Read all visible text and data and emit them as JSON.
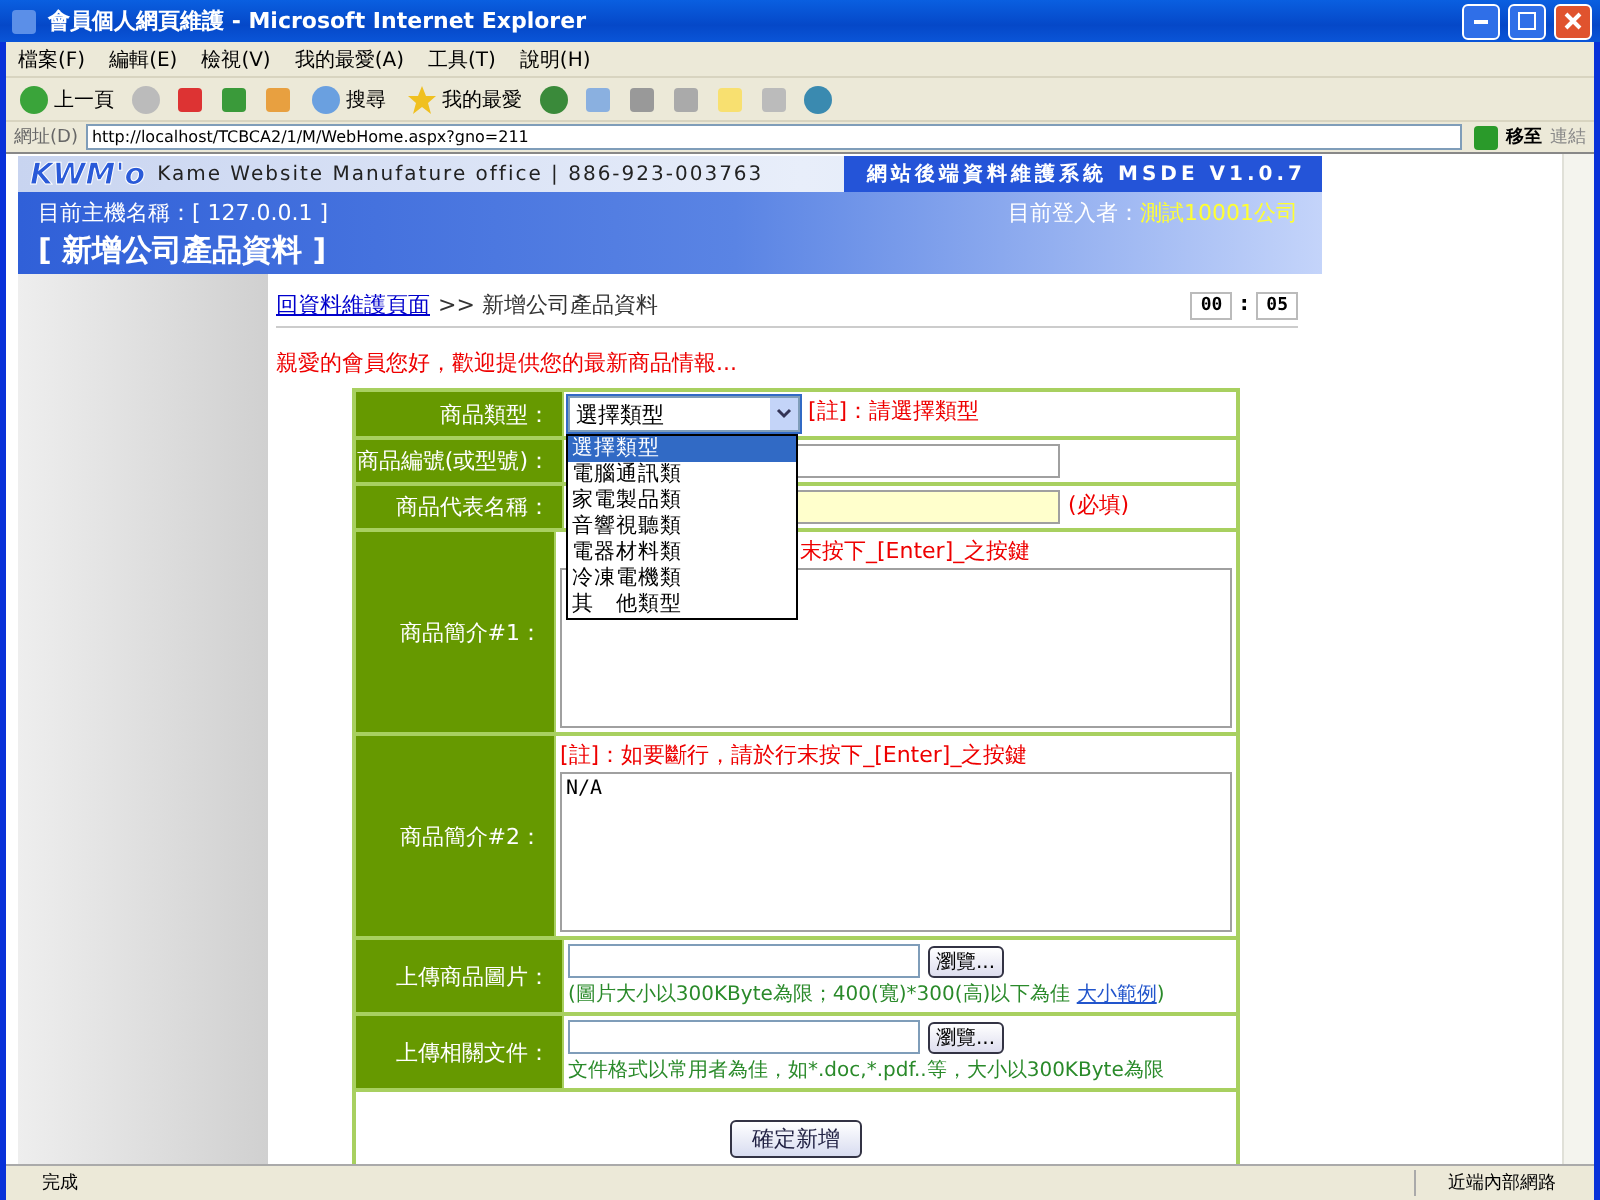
{
  "window": {
    "title": "會員個人網頁維護 - Microsoft Internet Explorer"
  },
  "menu": [
    "檔案(F)",
    "編輯(E)",
    "檢視(V)",
    "我的最愛(A)",
    "工具(T)",
    "說明(H)"
  ],
  "toolbar": {
    "back": "上一頁",
    "search": "搜尋",
    "favorites": "我的最愛"
  },
  "address": {
    "label": "網址(D)",
    "url": "http://localhost/TCBCA2/1/M/WebHome.aspx?gno=211",
    "go": "移至",
    "links": "連結"
  },
  "header": {
    "logo": "KWM'o",
    "company": "Kame Website Manufature office | 886-923-003763",
    "system": "網站後端資料維護系統 MSDE V1.0.7",
    "host": "目前主機名稱：[ 127.0.0.1 ]",
    "user_label": "目前登入者：",
    "user": "測試10001公司",
    "page_title": "[ 新增公司產品資料 ]"
  },
  "breadcrumb": {
    "link": "回資料維護頁面",
    "current": ">> 新增公司產品資料"
  },
  "timer": {
    "minutes": "00",
    "separator": ":",
    "seconds": "05"
  },
  "welcome": "親愛的會員您好，歡迎提供您的最新商品情報...",
  "form": {
    "rows": [
      {
        "kind": "select",
        "label": "商品類型：",
        "value": "選擇類型",
        "note": "[註]：請選擇類型",
        "expanded": true,
        "options": [
          {
            "label": "選擇類型",
            "selected": true
          },
          {
            "label": "電腦通訊類",
            "selected": false
          },
          {
            "label": "家電製品類",
            "selected": false
          },
          {
            "label": "音響視聽類",
            "selected": false
          },
          {
            "label": "電器材料類",
            "selected": false
          },
          {
            "label": "冷凍電機類",
            "selected": false
          },
          {
            "label": "其　他類型",
            "selected": false
          }
        ]
      },
      {
        "kind": "text",
        "label": "商品編號(或型號)：",
        "required": false
      },
      {
        "kind": "text",
        "label": "商品代表名稱：",
        "required": true,
        "note": "(必填)"
      },
      {
        "kind": "textarea",
        "label": "商品簡介#1：",
        "note": "末按下_[Enter]_之按鍵"
      },
      {
        "kind": "textarea",
        "label": "商品簡介#2：",
        "note": "[註]：如要斷行，請於行末按下_[Enter]_之按鍵",
        "value": "N/A"
      },
      {
        "kind": "file",
        "label": "上傳商品圖片：",
        "button": "瀏覽...",
        "hint": "(圖片大小以300KByte為限；400(寬)*300(高)以下為佳 ",
        "hint_link": "大小範例",
        "hint_end": ")"
      },
      {
        "kind": "file",
        "label": "上傳相關文件：",
        "button": "瀏覽...",
        "hint": "文件格式以常用者為佳，如*.doc,*.pdf..等，大小以300KByte為限"
      }
    ],
    "submit": "確定新增"
  },
  "status": {
    "text": "完成",
    "zone": "近端內部網路"
  }
}
